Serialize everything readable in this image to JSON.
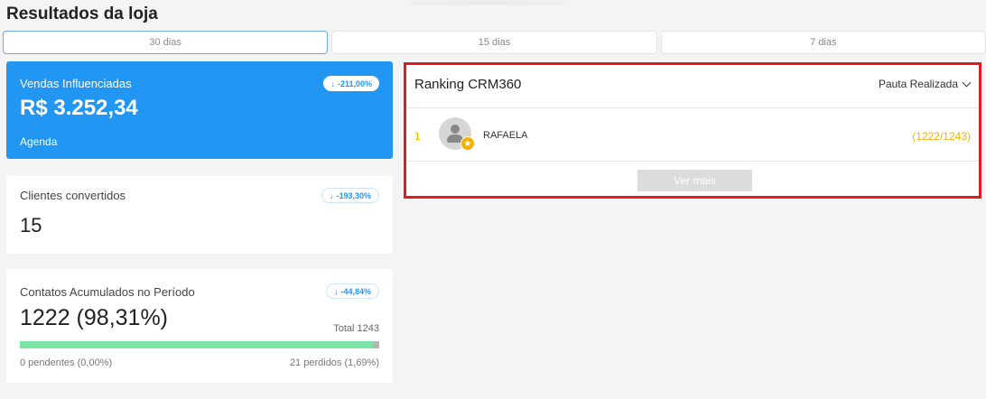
{
  "page": {
    "title": "Resultados da loja"
  },
  "tabs": [
    {
      "label": "30 dias"
    },
    {
      "label": "15 dias"
    },
    {
      "label": "7 dias"
    }
  ],
  "card_sales": {
    "label": "Vendas Influenciadas",
    "value": "R$ 3.252,34",
    "sub": "Agenda",
    "badge": "-211,00%"
  },
  "card_clients": {
    "label": "Clientes convertidos",
    "value": "15",
    "badge": "-193,30%"
  },
  "card_contacts": {
    "label": "Contatos Acumulados no Período",
    "value": "1222 (98,31%)",
    "total": "Total 1243",
    "badge": "-44,84%",
    "progress_percent": 98.31,
    "pending": "0 pendentes (0,00%)",
    "lost": "21 perdidos (1,69%)"
  },
  "ranking": {
    "title": "Ranking CRM360",
    "filter": "Pauta Realizada",
    "items": [
      {
        "rank": "1",
        "name": "RAFAELA",
        "score": "(1222/1243)"
      }
    ],
    "more_label": "Ver mais"
  },
  "colors": {
    "primary": "#2196f3",
    "ranking_accent": "#f2b000",
    "highlight_border": "#e01b24",
    "progress": "#7de4a8"
  }
}
